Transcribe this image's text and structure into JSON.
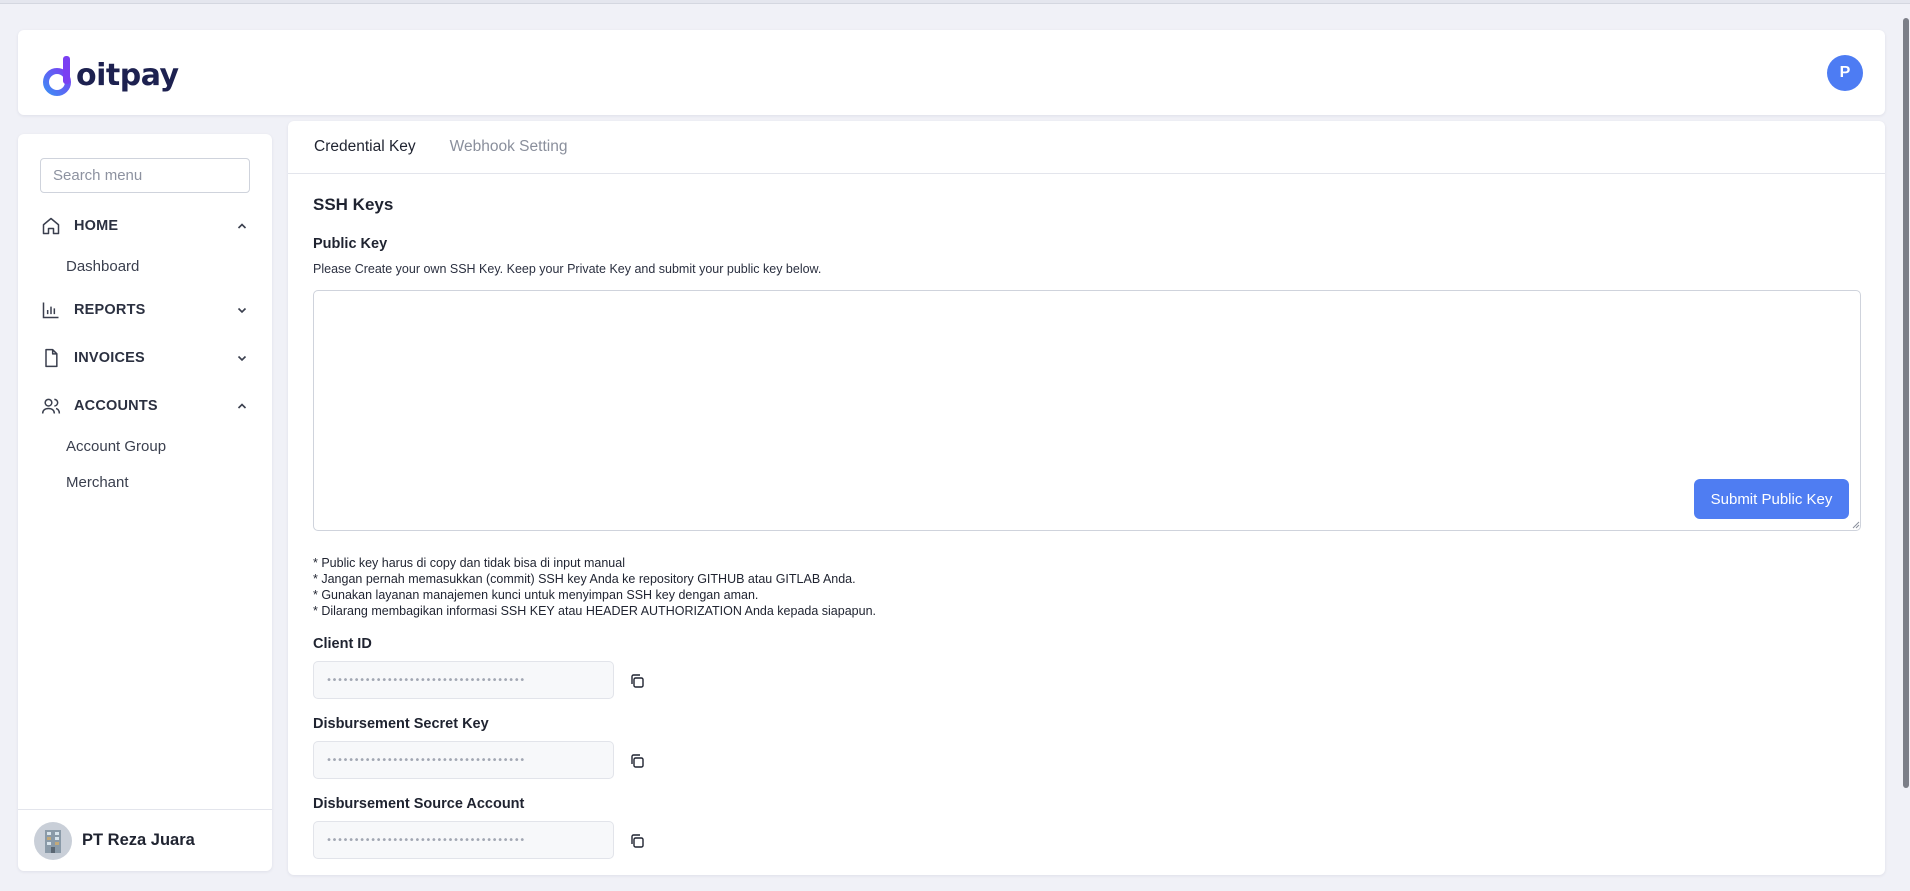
{
  "brand": {
    "logo_text": "oitpay",
    "logo_letter": "d"
  },
  "header": {
    "avatar_initial": "P"
  },
  "sidebar": {
    "search_placeholder": "Search menu",
    "groups": [
      {
        "label": "HOME",
        "icon": "home-icon",
        "expanded": true,
        "items": [
          "Dashboard"
        ]
      },
      {
        "label": "REPORTS",
        "icon": "bar-chart-icon",
        "expanded": false,
        "items": []
      },
      {
        "label": "INVOICES",
        "icon": "document-icon",
        "expanded": false,
        "items": []
      },
      {
        "label": "ACCOUNTS",
        "icon": "users-icon",
        "expanded": true,
        "items": [
          "Account Group",
          "Merchant"
        ]
      }
    ],
    "company_name": "PT Reza Juara"
  },
  "tabs": [
    {
      "label": "Credential Key",
      "active": true
    },
    {
      "label": "Webhook Setting",
      "active": false
    }
  ],
  "main": {
    "section_title": "SSH Keys",
    "public_key_label": "Public Key",
    "public_key_help": "Please Create your own SSH Key. Keep your Private Key and submit your public key below.",
    "public_key_value": "",
    "submit_label": "Submit Public Key",
    "notes": [
      "* Public key harus di copy dan tidak bisa di input manual",
      "* Jangan pernah memasukkan (commit) SSH key Anda ke repository GITHUB atau GITLAB Anda.",
      "* Gunakan layanan manajemen kunci untuk menyimpan SSH key dengan aman.",
      "* Dilarang membagikan informasi SSH KEY atau HEADER AUTHORIZATION Anda kepada siapapun."
    ],
    "fields": [
      {
        "label": "Client ID",
        "value": "••••••••••••••••••••••••••••••••••••"
      },
      {
        "label": "Disbursement Secret Key",
        "value": "••••••••••••••••••••••••••••••••••••"
      },
      {
        "label": "Disbursement Source Account",
        "value": "••••••••••••••••••••••••••••••••••••"
      }
    ]
  },
  "colors": {
    "accent": "#4f7df2",
    "brand_dark": "#1d2150",
    "brand_purple": "#7a3ff2",
    "brand_blue": "#3f8cf5"
  }
}
